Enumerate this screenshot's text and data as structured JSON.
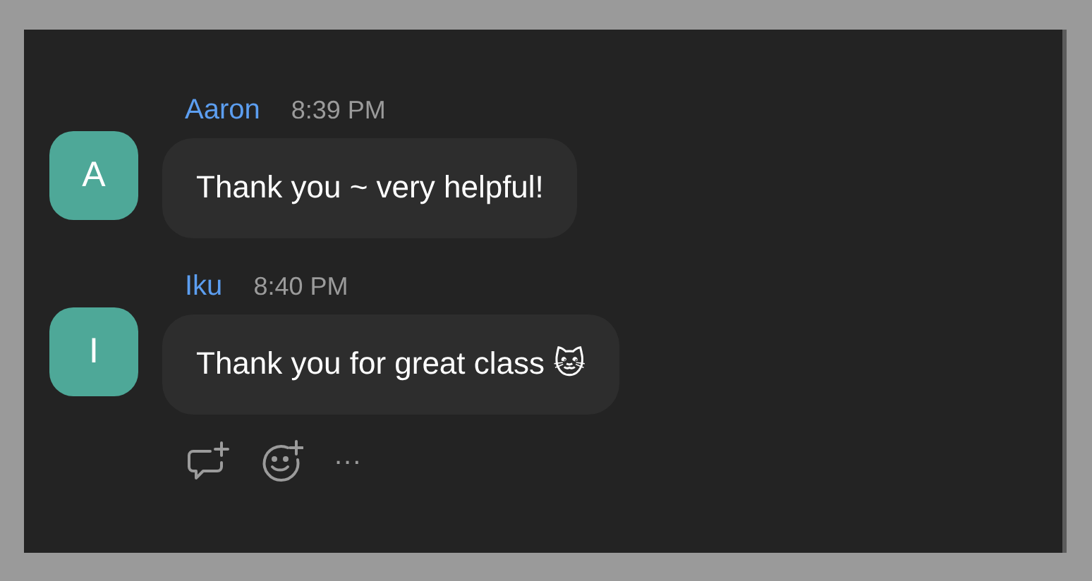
{
  "messages": [
    {
      "sender": "Aaron",
      "avatar_letter": "A",
      "time": "8:39 PM",
      "text": "Thank you ~ very helpful!"
    },
    {
      "sender": "Iku",
      "avatar_letter": "I",
      "time": "8:40 PM",
      "text": "Thank you for great class 🐱"
    }
  ],
  "message_actions": {
    "more": "..."
  }
}
